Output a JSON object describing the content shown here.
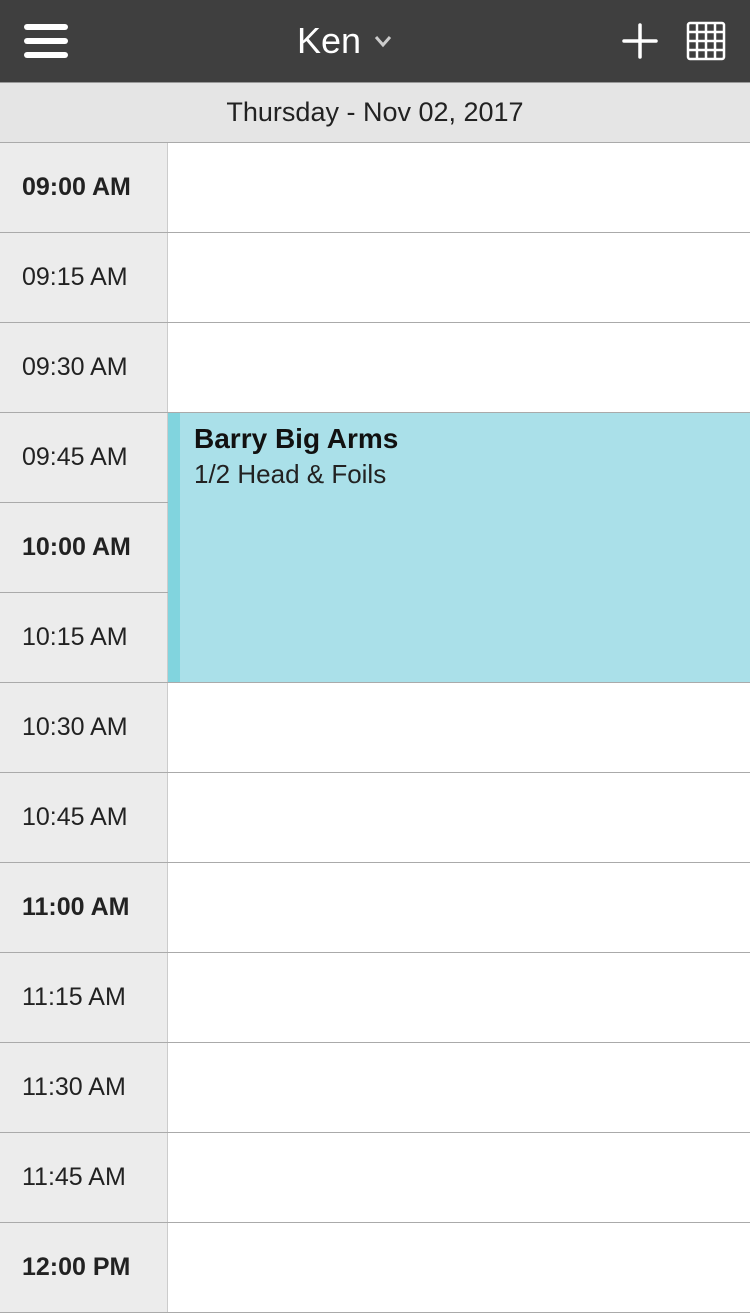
{
  "header": {
    "title": "Ken"
  },
  "date": "Thursday - Nov 02, 2017",
  "timeSlots": [
    {
      "label": "09:00 AM",
      "bold": true
    },
    {
      "label": "09:15 AM",
      "bold": false
    },
    {
      "label": "09:30 AM",
      "bold": false
    },
    {
      "label": "09:45 AM",
      "bold": false
    },
    {
      "label": "10:00 AM",
      "bold": true
    },
    {
      "label": "10:15 AM",
      "bold": false
    },
    {
      "label": "10:30 AM",
      "bold": false
    },
    {
      "label": "10:45 AM",
      "bold": false
    },
    {
      "label": "11:00 AM",
      "bold": true
    },
    {
      "label": "11:15 AM",
      "bold": false
    },
    {
      "label": "11:30 AM",
      "bold": false
    },
    {
      "label": "11:45 AM",
      "bold": false
    },
    {
      "label": "12:00 PM",
      "bold": true
    }
  ],
  "event": {
    "title": "Barry Big Arms",
    "subtitle": "1/2 Head & Foils",
    "startIndex": 3,
    "duration": 3
  }
}
